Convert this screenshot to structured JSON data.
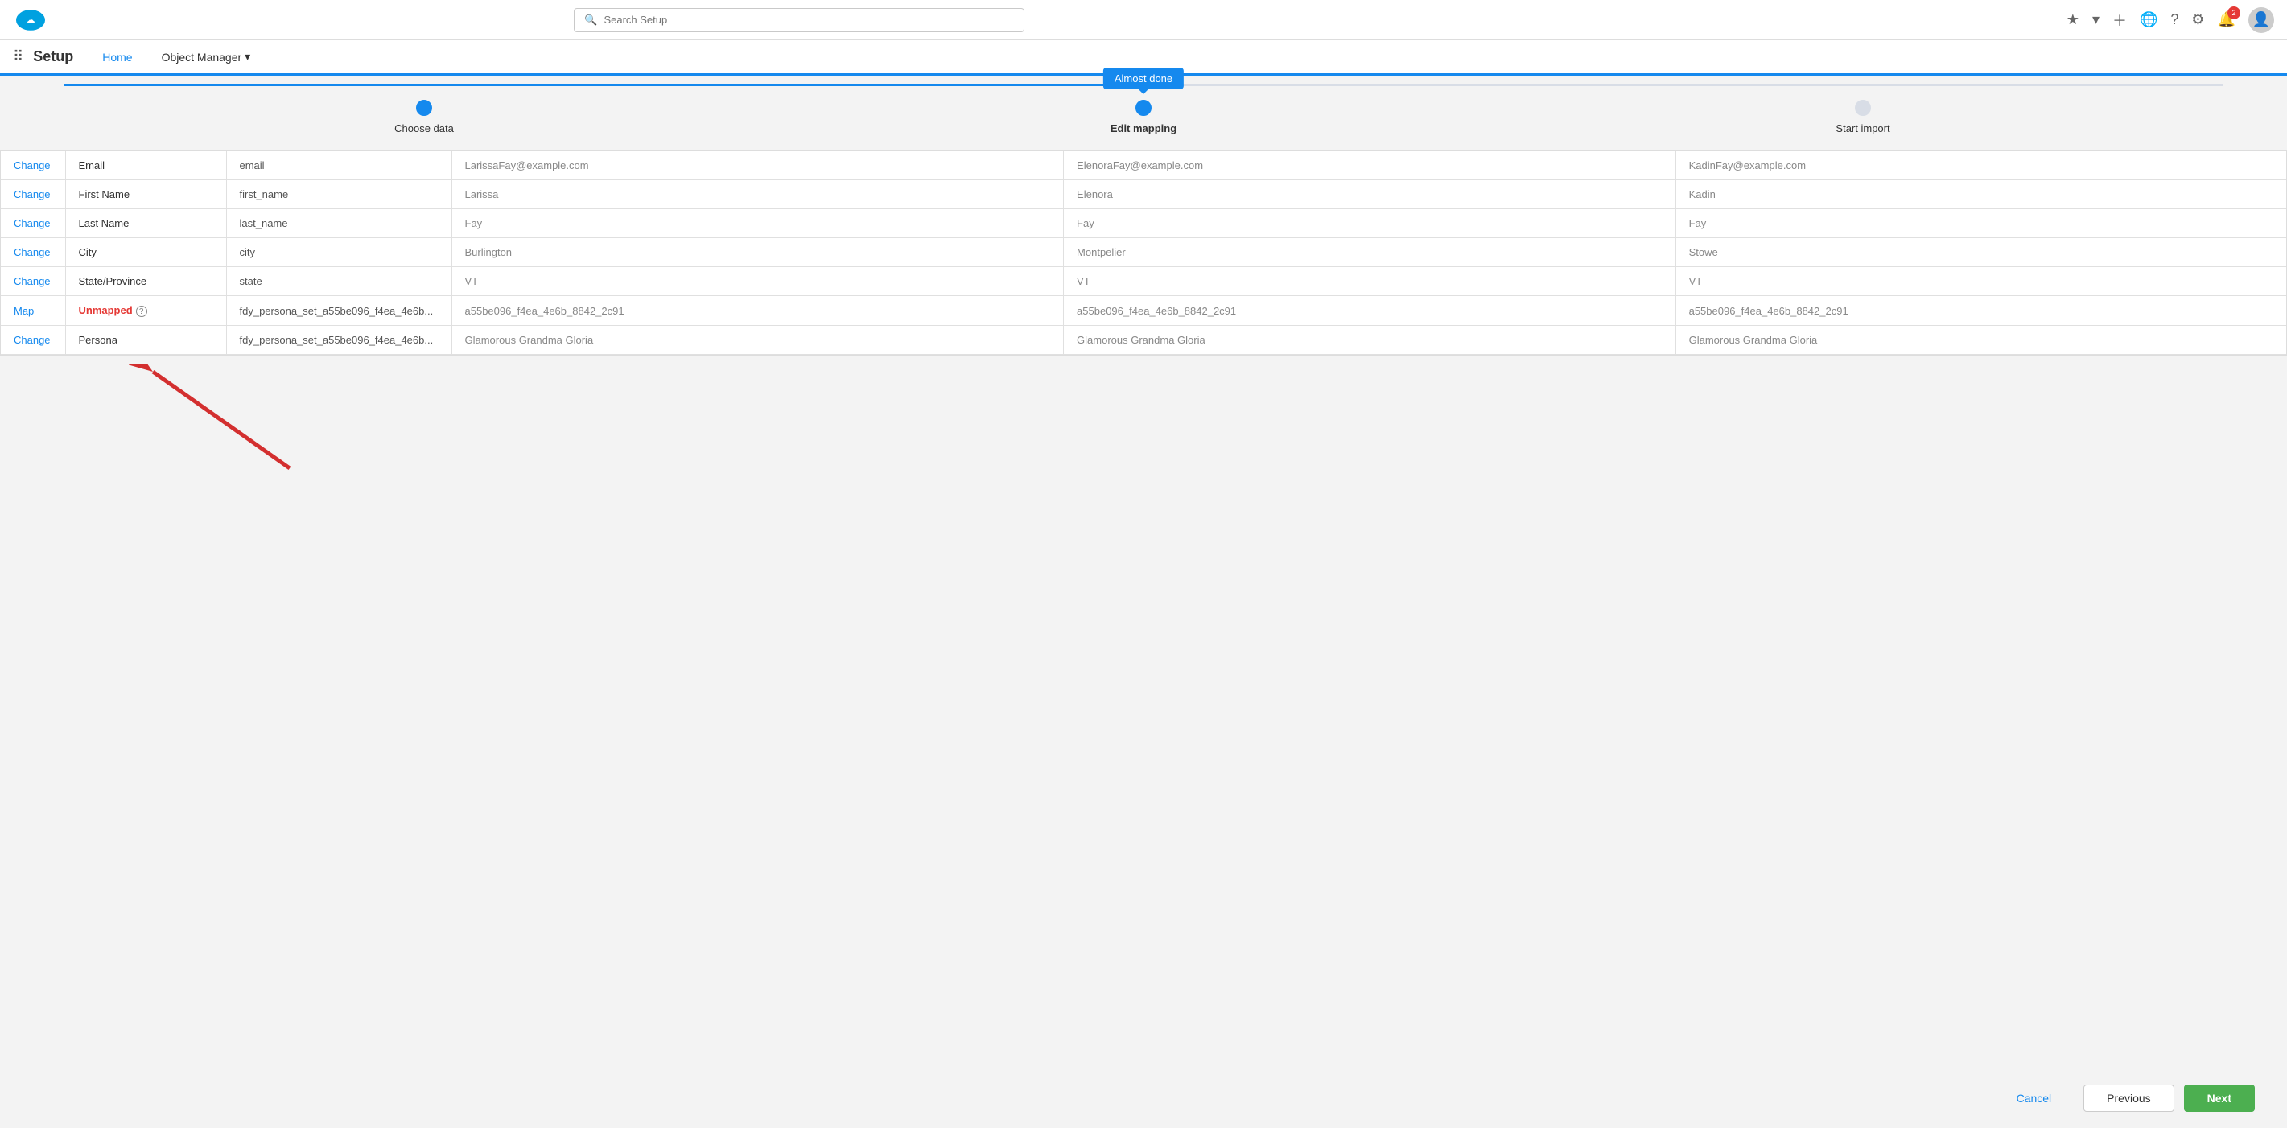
{
  "appTitle": "Setup",
  "nav": {
    "search_placeholder": "Search Setup",
    "tabs": [
      {
        "label": "Home",
        "active": true
      },
      {
        "label": "Object Manager",
        "has_arrow": true
      }
    ],
    "icons": [
      "★",
      "▾",
      "+",
      "🌐",
      "?",
      "⚙"
    ],
    "notification_count": "2"
  },
  "progress": {
    "tooltip": "Almost done",
    "steps": [
      {
        "label": "Choose data",
        "state": "done"
      },
      {
        "label": "Edit mapping",
        "state": "active",
        "bold": true
      },
      {
        "label": "Start import",
        "state": "inactive"
      }
    ]
  },
  "table": {
    "rows": [
      {
        "action": "Change",
        "field": "Email",
        "mapping": "email",
        "col1": "LarissaFay@example.com",
        "col2": "ElenoraFay@example.com",
        "col3": "KadinFay@example.com"
      },
      {
        "action": "Change",
        "field": "First Name",
        "mapping": "first_name",
        "col1": "Larissa",
        "col2": "Elenora",
        "col3": "Kadin"
      },
      {
        "action": "Change",
        "field": "Last Name",
        "mapping": "last_name",
        "col1": "Fay",
        "col2": "Fay",
        "col3": "Fay"
      },
      {
        "action": "Change",
        "field": "City",
        "mapping": "city",
        "col1": "Burlington",
        "col2": "Montpelier",
        "col3": "Stowe"
      },
      {
        "action": "Change",
        "field": "State/Province",
        "mapping": "state",
        "col1": "VT",
        "col2": "VT",
        "col3": "VT"
      },
      {
        "action": "Map",
        "field": "Unmapped",
        "field_type": "unmapped",
        "mapping": "fdy_persona_set_a55be096_f4ea_4e6b...",
        "col1": "a55be096_f4ea_4e6b_8842_2c91",
        "col2": "a55be096_f4ea_4e6b_8842_2c91",
        "col3": "a55be096_f4ea_4e6b_8842_2c91"
      },
      {
        "action": "Change",
        "field": "Persona",
        "mapping": "fdy_persona_set_a55be096_f4ea_4e6b...",
        "col1": "Glamorous Grandma Gloria",
        "col2": "Glamorous Grandma Gloria",
        "col3": "Glamorous Grandma Gloria"
      }
    ]
  },
  "footer": {
    "cancel_label": "Cancel",
    "previous_label": "Previous",
    "next_label": "Next"
  }
}
